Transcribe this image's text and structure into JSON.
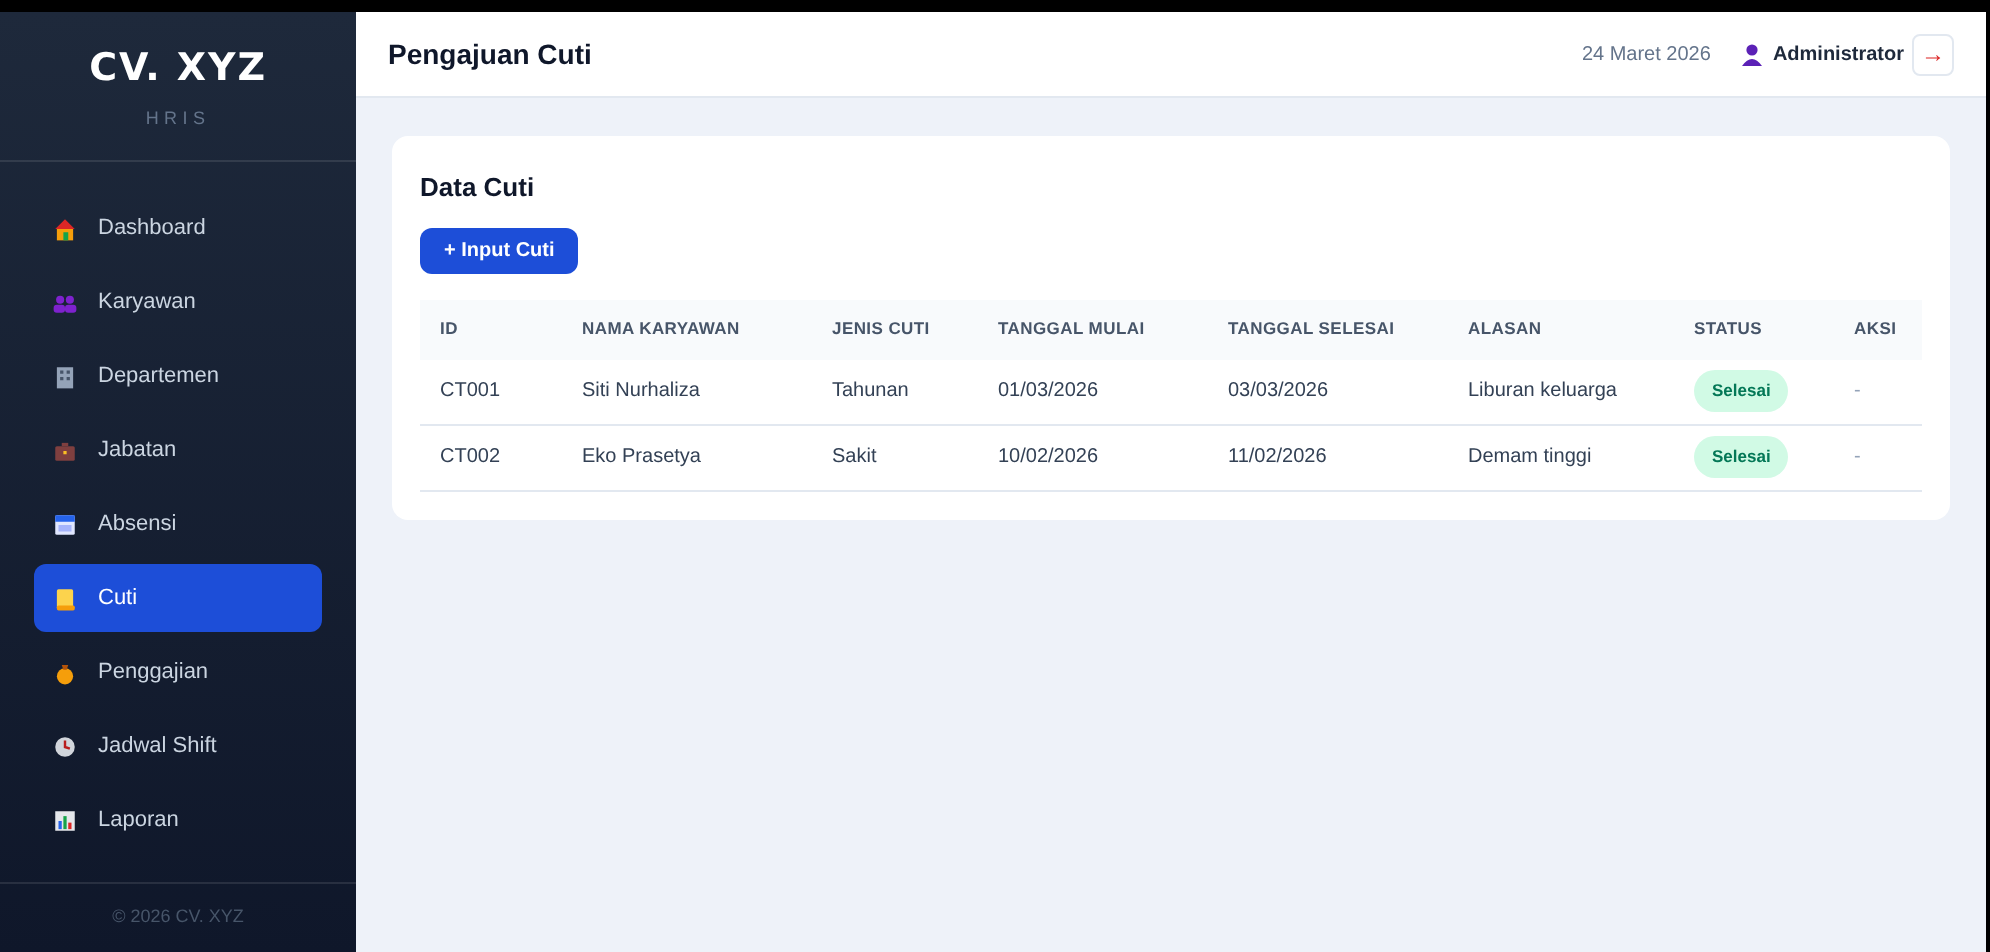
{
  "sidebar": {
    "logo": "CV. XYZ",
    "subtitle": "HRIS",
    "items": [
      {
        "label": "Dashboard",
        "selected": false
      },
      {
        "label": "Karyawan",
        "selected": false
      },
      {
        "label": "Departemen",
        "selected": false
      },
      {
        "label": "Jabatan",
        "selected": false
      },
      {
        "label": "Absensi",
        "selected": false
      },
      {
        "label": "Cuti",
        "selected": true
      },
      {
        "label": "Penggajian",
        "selected": false
      },
      {
        "label": "Jadwal Shift",
        "selected": false
      },
      {
        "label": "Laporan",
        "selected": false
      }
    ],
    "footer": "© 2026 CV. XYZ"
  },
  "header": {
    "title": "Pengajuan Cuti",
    "date": "24 Maret 2026",
    "user": "Administrator",
    "logout_icon": "→"
  },
  "card": {
    "title": "Data Cuti",
    "add_button": "+ Input Cuti",
    "table": {
      "columns": [
        "ID",
        "NAMA KARYAWAN",
        "JENIS CUTI",
        "TANGGAL MULAI",
        "TANGGAL SELESAI",
        "ALASAN",
        "STATUS",
        "AKSI"
      ],
      "rows": [
        {
          "id": "CT001",
          "name": "Siti Nurhaliza",
          "type": "Tahunan",
          "start": "01/03/2026",
          "end": "03/03/2026",
          "reason": "Liburan keluarga",
          "status": "Selesai",
          "action": "-"
        },
        {
          "id": "CT002",
          "name": "Eko Prasetya",
          "type": "Sakit",
          "start": "10/02/2026",
          "end": "11/02/2026",
          "reason": "Demam tinggi",
          "status": "Selesai",
          "action": "-"
        }
      ]
    }
  }
}
